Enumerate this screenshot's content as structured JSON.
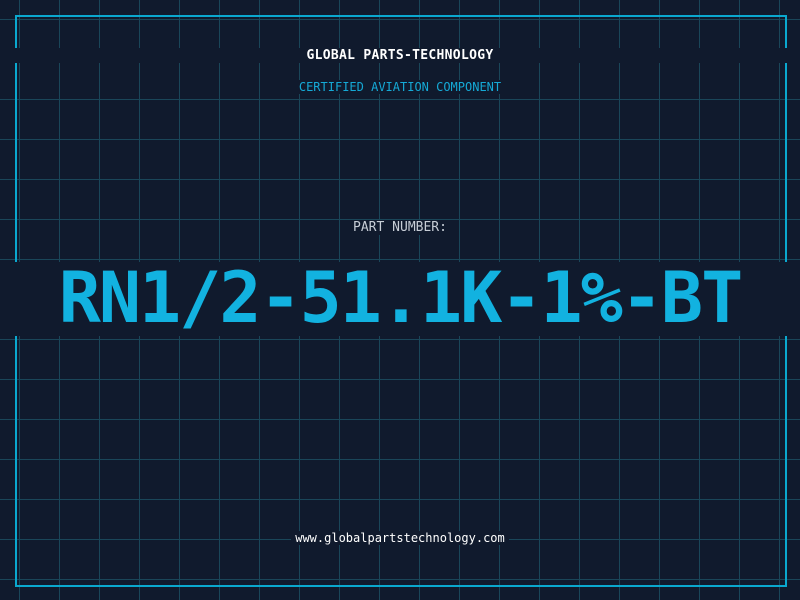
{
  "company": "GLOBAL PARTS-TECHNOLOGY",
  "subtitle": "CERTIFIED AVIATION COMPONENT",
  "part_label": "PART NUMBER:",
  "part_number": "RN1/2-51.1K-1%-BT",
  "website": "www.globalpartstechnology.com",
  "colors": {
    "background": "#101a2d",
    "grid": "#1a4659",
    "accent": "#12b2e0",
    "frame": "#0aa8cf"
  }
}
